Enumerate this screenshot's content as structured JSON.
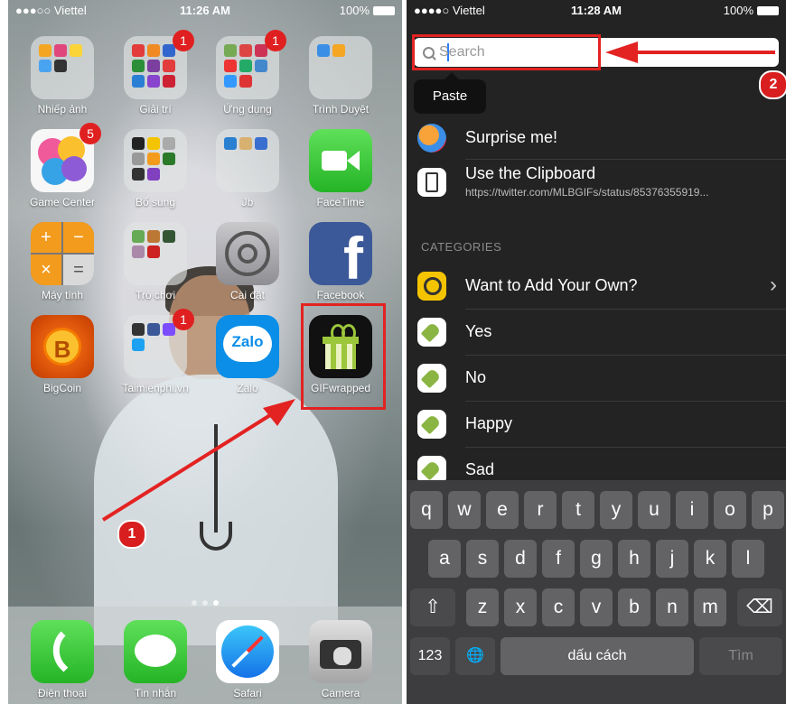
{
  "left": {
    "status": {
      "carrier": "●●●○○ Viettel",
      "time": "11:26 AM",
      "battery": "100%"
    },
    "apps": [
      {
        "label": "Nhiếp ảnh",
        "badge": ""
      },
      {
        "label": "Giải trí",
        "badge": "1"
      },
      {
        "label": "Ứng dụng",
        "badge": "1"
      },
      {
        "label": "Trình Duyệt",
        "badge": ""
      },
      {
        "label": "Game Center",
        "badge": "5"
      },
      {
        "label": "Bổ sung",
        "badge": ""
      },
      {
        "label": "Jb",
        "badge": ""
      },
      {
        "label": "FaceTime",
        "badge": ""
      },
      {
        "label": "Máy tính",
        "badge": ""
      },
      {
        "label": "Trò chơi",
        "badge": ""
      },
      {
        "label": "Cài đặt",
        "badge": ""
      },
      {
        "label": "Facebook",
        "badge": ""
      },
      {
        "label": "BigCoin",
        "badge": ""
      },
      {
        "label": "Taimienphi.vn",
        "badge": "1"
      },
      {
        "label": "Zalo",
        "badge": ""
      },
      {
        "label": "GIFwrapped",
        "badge": ""
      }
    ],
    "icon_text": {
      "zalo": "Zalo",
      "facebook": "f",
      "bigcoin": "B",
      "calc_plus": "+",
      "calc_minus": "−",
      "calc_times": "×",
      "calc_equals": "="
    },
    "dock": [
      {
        "label": "Điện thoại"
      },
      {
        "label": "Tin nhắn"
      },
      {
        "label": "Safari"
      },
      {
        "label": "Camera"
      }
    ],
    "step_badge": "1"
  },
  "right": {
    "status": {
      "carrier": "●●●●○ Viettel",
      "time": "11:28 AM",
      "battery": "100%"
    },
    "search": {
      "placeholder": "Search",
      "value": ""
    },
    "paste_label": "Paste",
    "step_badge": "2",
    "top_items": [
      {
        "title": "Surprise me!",
        "subtitle": ""
      },
      {
        "title": "Use the Clipboard",
        "subtitle": "https://twitter.com/MLBGIFs/status/85376355919..."
      }
    ],
    "categories_header": "CATEGORIES",
    "categories": [
      {
        "title": "Want to Add Your Own?",
        "chevron": "›"
      },
      {
        "title": "Yes"
      },
      {
        "title": "No"
      },
      {
        "title": "Happy"
      },
      {
        "title": "Sad"
      }
    ],
    "keyboard": {
      "row1": [
        "q",
        "w",
        "e",
        "r",
        "t",
        "y",
        "u",
        "i",
        "o",
        "p"
      ],
      "row2": [
        "a",
        "s",
        "d",
        "f",
        "g",
        "h",
        "j",
        "k",
        "l"
      ],
      "row3": [
        "z",
        "x",
        "c",
        "v",
        "b",
        "n",
        "m"
      ],
      "shift": "⇧",
      "backspace": "⌫",
      "numbers": "123",
      "globe": "🌐",
      "space": "dấu cách",
      "search": "Tìm"
    }
  },
  "colors": {
    "highlight_red": "#e32222",
    "keyboard_bg": "#3d3d3f",
    "panel_dark": "#232323"
  }
}
